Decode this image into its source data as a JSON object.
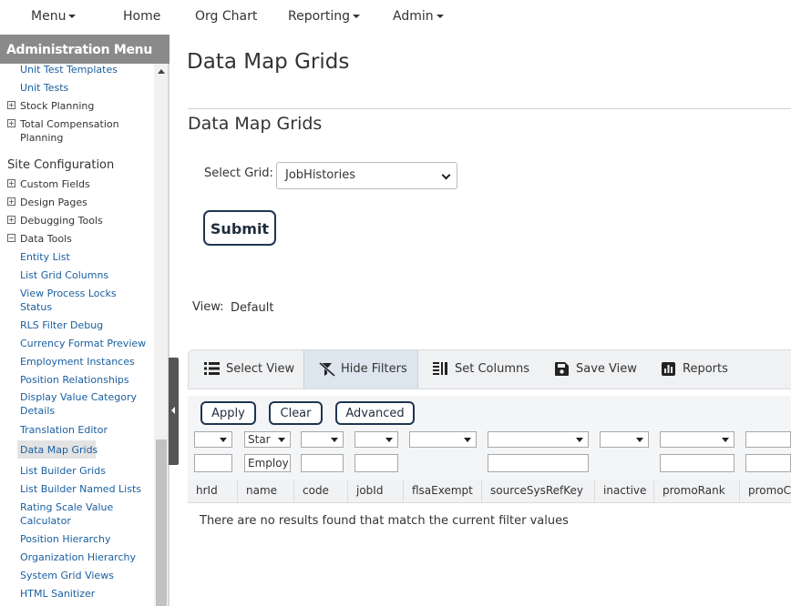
{
  "nav": {
    "menu": "Menu",
    "home": "Home",
    "org_chart": "Org Chart",
    "reporting": "Reporting",
    "admin": "Admin"
  },
  "sidebar": {
    "title": "Administration Menu",
    "items_top": {
      "unit_test_templates": "Unit Test Templates",
      "unit_tests": "Unit Tests",
      "stock_planning": "Stock Planning",
      "total_comp_1": "Total Compensation",
      "total_comp_2": "Planning"
    },
    "site_configuration": "Site Configuration",
    "groups": {
      "custom_fields": "Custom Fields",
      "design_pages": "Design Pages",
      "debugging_tools": "Debugging Tools",
      "data_tools": "Data Tools"
    },
    "links": {
      "entity_list": "Entity List",
      "list_grid_columns": "List Grid Columns",
      "view_process_locks_1": "View Process Locks",
      "view_process_locks_2": "Status",
      "rls_filter_debug": "RLS Filter Debug",
      "currency_format_preview": "Currency Format Preview",
      "employment_instances": "Employment Instances",
      "position_relationships": "Position Relationships",
      "display_value_1": "Display Value Category",
      "display_value_2": "Details",
      "translation_editor": "Translation Editor",
      "data_map_grids": "Data Map Grids",
      "list_builder_grids": "List Builder Grids",
      "list_builder_named_lists": "List Builder Named Lists",
      "rating_scale_1": "Rating Scale Value",
      "rating_scale_2": "Calculator",
      "position_hierarchy": "Position Hierarchy",
      "organization_hierarchy": "Organization Hierarchy",
      "system_grid_views": "System Grid Views",
      "html_sanitizer": "HTML Sanitizer"
    }
  },
  "main": {
    "page_title": "Data Map Grids",
    "section_title": "Data Map Grids",
    "select_label": "Select Grid:",
    "select_value": "JobHistories",
    "submit": "Submit",
    "view_label": "View:",
    "view_value": "Default"
  },
  "toolbar": {
    "select_view": "Select View",
    "hide_filters": "Hide Filters",
    "set_columns": "Set Columns",
    "save_view": "Save View",
    "reports": "Reports"
  },
  "filters": {
    "apply": "Apply",
    "clear": "Clear",
    "advanced": "Advanced",
    "name_operator": "Star",
    "name_value": "Employ"
  },
  "grid": {
    "columns": [
      "hrId",
      "name",
      "code",
      "jobId",
      "flsaExempt",
      "sourceSysRefKey",
      "inactive",
      "promoRank",
      "promoC"
    ],
    "empty_message": "There are no results found that match the current filter values"
  }
}
